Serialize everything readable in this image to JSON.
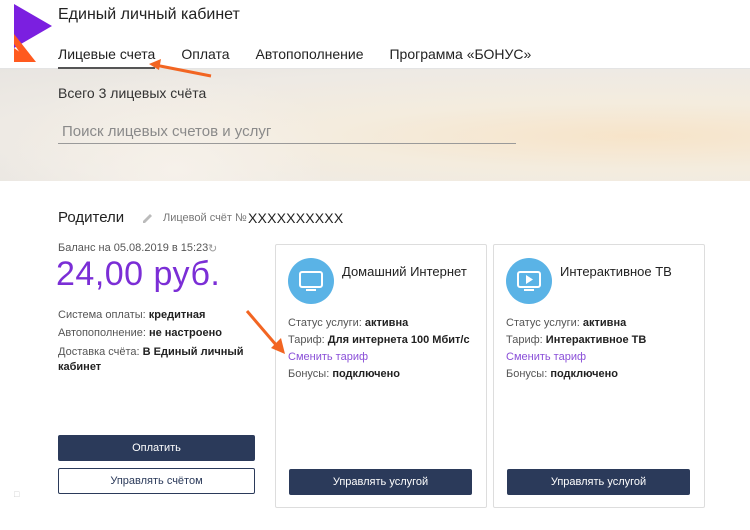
{
  "header": {
    "title": "Единый личный кабинет",
    "nav": [
      "Лицевые счета",
      "Оплата",
      "Автопополнение",
      "Программа «БОНУС»"
    ],
    "active_index": 0
  },
  "banner": {
    "total": "Всего 3 лицевых счёта",
    "search_placeholder": "Поиск лицевых счетов и услуг"
  },
  "account": {
    "name": "Родители",
    "number_label": "Лицевой счёт №",
    "number": "XXXXXXXXXX",
    "balance_label": "Баланс на 05.08.2019 в 15:23",
    "balance": "24,00 руб.",
    "info": [
      {
        "label": "Система оплаты:",
        "value": "кредитная"
      },
      {
        "label": "Автопополнение:",
        "value": "не настроено"
      },
      {
        "label": "Доставка счёта:",
        "value": "В Единый личный"
      },
      {
        "label": "",
        "value": "кабинет"
      }
    ],
    "pay_button": "Оплатить",
    "manage_button": "Управлять счётом"
  },
  "services": [
    {
      "title": "Домашний Интернет",
      "icon": "monitor-icon",
      "status_label": "Статус услуги:",
      "status": "активна",
      "tariff_label": "Тариф:",
      "tariff": "Для интернета 100 Мбит/с",
      "change_link": "Сменить тариф",
      "bonus_label": "Бонусы:",
      "bonus": "подключено",
      "button": "Управлять услугой"
    },
    {
      "title": "Интерактивное ТВ",
      "icon": "tv-play-icon",
      "status_label": "Статус услуги:",
      "status": "активна",
      "tariff_label": "Тариф:",
      "tariff": "Интерактивное ТВ",
      "change_link": "Сменить тариф",
      "bonus_label": "Бонусы:",
      "bonus": "подключено",
      "button": "Управлять услугой"
    }
  ],
  "colors": {
    "accent_purple": "#7b2ed6",
    "button_navy": "#2b3a5a",
    "icon_blue": "#5ab3e6",
    "annotation_orange": "#f26522",
    "logo_purple": "#7b1fe0"
  }
}
